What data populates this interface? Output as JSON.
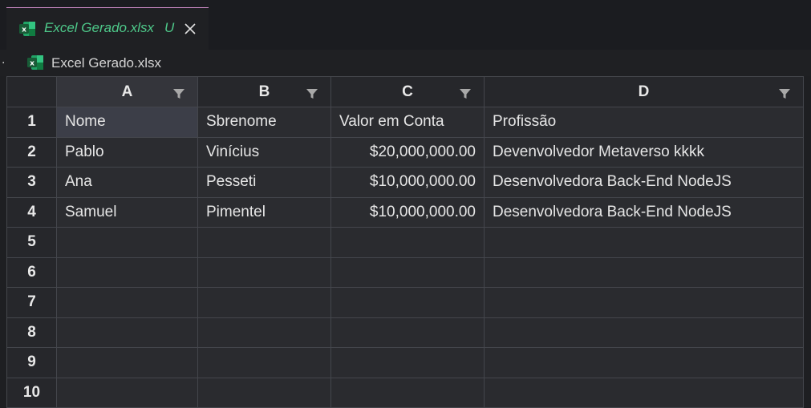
{
  "tab": {
    "title": "Excel Gerado.xlsx",
    "status": "U",
    "icon": "excel-file-icon",
    "accent_color": "#4ec98a"
  },
  "breadcrumb": {
    "label": "Excel Gerado.xlsx",
    "icon": "excel-file-icon"
  },
  "sheet": {
    "columns": [
      "A",
      "B",
      "C",
      "D"
    ],
    "rows": [
      {
        "num": "1",
        "cells": [
          "Nome",
          "Sbrenome",
          "Valor em Conta",
          "Profissão"
        ]
      },
      {
        "num": "2",
        "cells": [
          "Pablo",
          "Vinícius",
          "$20,000,000.00",
          "Devenvolvedor Metaverso kkkk"
        ]
      },
      {
        "num": "3",
        "cells": [
          "Ana",
          "Pesseti",
          "$10,000,000.00",
          "Desenvolvedora Back-End NodeJS"
        ]
      },
      {
        "num": "4",
        "cells": [
          "Samuel",
          "Pimentel",
          "$10,000,000.00",
          "Desenvolvedora Back-End NodeJS"
        ]
      },
      {
        "num": "5",
        "cells": [
          "",
          "",
          "",
          ""
        ]
      },
      {
        "num": "6",
        "cells": [
          "",
          "",
          "",
          ""
        ]
      },
      {
        "num": "7",
        "cells": [
          "",
          "",
          "",
          ""
        ]
      },
      {
        "num": "8",
        "cells": [
          "",
          "",
          "",
          ""
        ]
      },
      {
        "num": "9",
        "cells": [
          "",
          "",
          "",
          ""
        ]
      },
      {
        "num": "10",
        "cells": [
          "",
          "",
          "",
          ""
        ]
      }
    ],
    "selected_cell": "A1"
  }
}
